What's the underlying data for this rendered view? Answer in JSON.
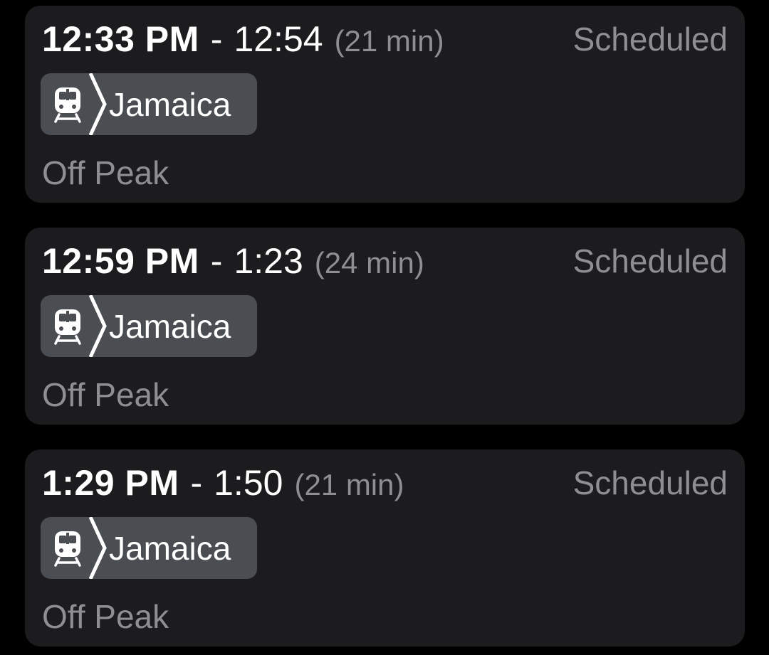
{
  "trips": [
    {
      "depart": "12:33 PM",
      "separator": "-",
      "arrive": "12:54",
      "duration": "(21 min)",
      "status": "Scheduled",
      "route": {
        "icon": "train-icon",
        "name": "Jamaica"
      },
      "fare": "Off Peak"
    },
    {
      "depart": "12:59 PM",
      "separator": "-",
      "arrive": "1:23",
      "duration": "(24 min)",
      "status": "Scheduled",
      "route": {
        "icon": "train-icon",
        "name": "Jamaica"
      },
      "fare": "Off Peak"
    },
    {
      "depart": "1:29 PM",
      "separator": "-",
      "arrive": "1:50",
      "duration": "(21 min)",
      "status": "Scheduled",
      "route": {
        "icon": "train-icon",
        "name": "Jamaica"
      },
      "fare": "Off Peak"
    }
  ],
  "colors": {
    "background": "#000000",
    "card": "#1c1c1e",
    "badge": "#4a4d52",
    "primary_text": "#ffffff",
    "secondary_text": "#8e8e93"
  }
}
